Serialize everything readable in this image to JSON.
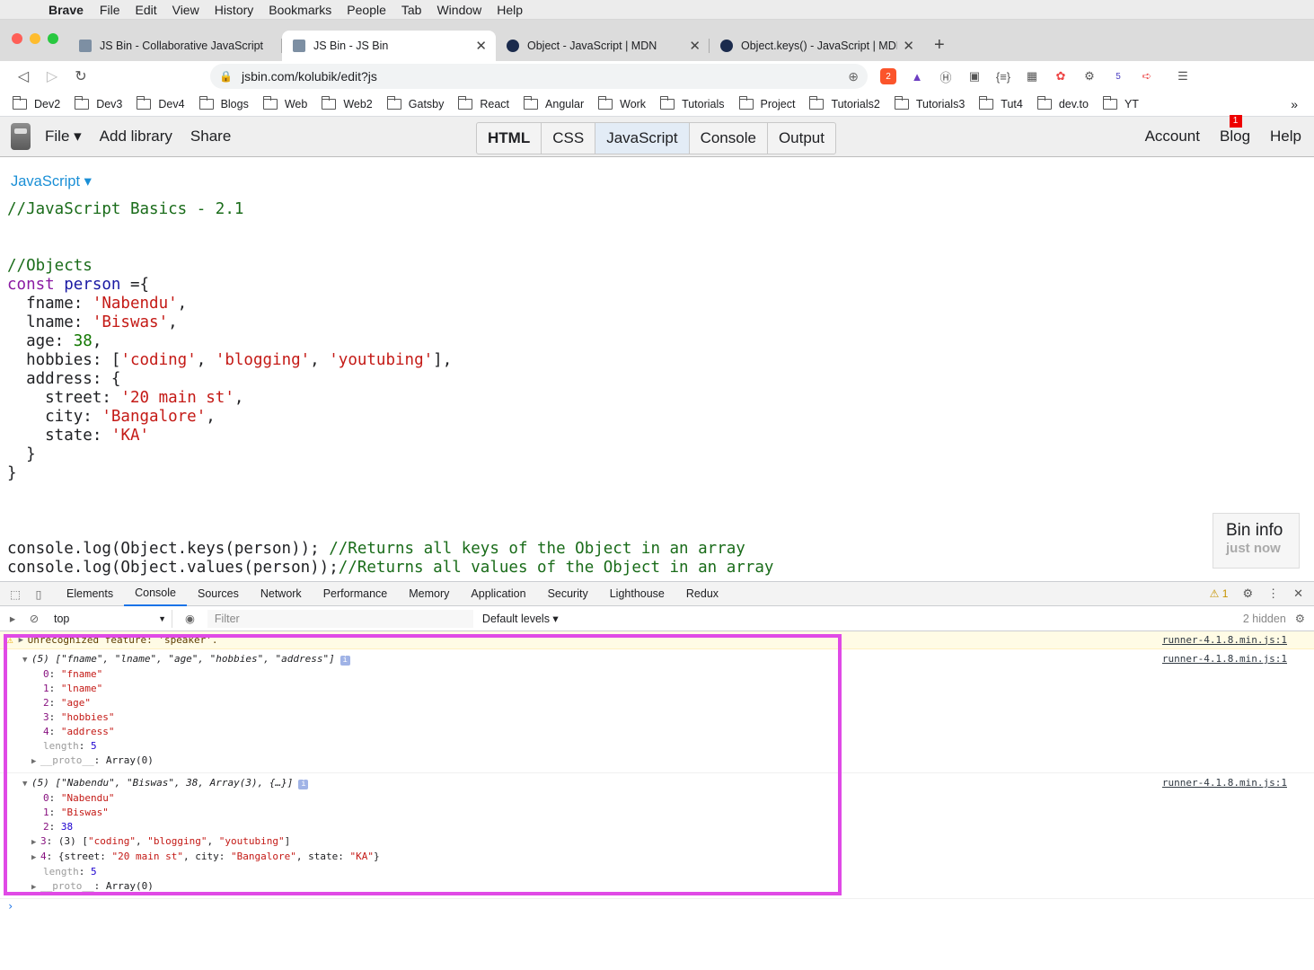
{
  "macmenu": {
    "app": "Brave",
    "items": [
      "File",
      "Edit",
      "View",
      "History",
      "Bookmarks",
      "People",
      "Tab",
      "Window",
      "Help"
    ]
  },
  "tabs": [
    {
      "title": "JS Bin - Collaborative JavaScript",
      "active": false
    },
    {
      "title": "JS Bin - JS Bin",
      "active": true
    },
    {
      "title": "Object - JavaScript | MDN",
      "active": false
    },
    {
      "title": "Object.keys() - JavaScript | MDN",
      "active": false
    }
  ],
  "url": "jsbin.com/kolubik/edit?js",
  "shield_count": "2",
  "ext_badge": "5",
  "bookmarks": [
    "Dev2",
    "Dev3",
    "Dev4",
    "Blogs",
    "Web",
    "Web2",
    "Gatsby",
    "React",
    "Angular",
    "Work",
    "Tutorials",
    "Project",
    "Tutorials2",
    "Tutorials3",
    "Tut4",
    "dev.to",
    "YT"
  ],
  "jsbin": {
    "menu": {
      "file": "File ▾",
      "add_library": "Add library",
      "share": "Share"
    },
    "panels": [
      "HTML",
      "CSS",
      "JavaScript",
      "Console",
      "Output"
    ],
    "right": {
      "account": "Account",
      "blog": "Blog",
      "blog_badge": "1",
      "help": "Help"
    },
    "editor_lang": "JavaScript ▾",
    "bininfo": {
      "title": "Bin info",
      "time": "just now"
    }
  },
  "code": {
    "l1": "//JavaScript Basics - 2.1",
    "l2": "//Objects",
    "kw_const": "const",
    "var_person": "person",
    "l3_rest": " ={",
    "fname_k": "  fname: ",
    "fname_v": "'Nabendu'",
    "lname_k": "  lname: ",
    "lname_v": "'Biswas'",
    "age_k": "  age: ",
    "age_v": "38",
    "hob_k": "  hobbies: [",
    "hob_1": "'coding'",
    "hob_2": "'blogging'",
    "hob_3": "'youtubing'",
    "hob_end": "],",
    "addr": "  address: {",
    "street_k": "    street: ",
    "street_v": "'20 main st'",
    "city_k": "    city: ",
    "city_v": "'Bangalore'",
    "state_k": "    state: ",
    "state_v": "'KA'",
    "close1": "  }",
    "close2": "}",
    "log1_code": "console.log(Object.keys(person)); ",
    "log1_cm": "//Returns all keys of the Object in an array",
    "log2_code": "console.log(Object.values(person));",
    "log2_cm": "//Returns all values of the Object in an array"
  },
  "devtools": {
    "tabs": [
      "Elements",
      "Console",
      "Sources",
      "Network",
      "Performance",
      "Memory",
      "Application",
      "Security",
      "Lighthouse",
      "Redux"
    ],
    "active_tab": "Console",
    "warn_count": "1",
    "context": "top",
    "filter_placeholder": "Filter",
    "levels": "Default levels ▾",
    "hidden": "2 hidden"
  },
  "console": {
    "warning": "Unrecognized feature: 'speaker'.",
    "source": "runner-4.1.8.min.js:1",
    "keys_header": "(5) [\"fname\", \"lname\", \"age\", \"hobbies\", \"address\"]",
    "keys": [
      {
        "i": "0",
        "v": "\"fname\""
      },
      {
        "i": "1",
        "v": "\"lname\""
      },
      {
        "i": "2",
        "v": "\"age\""
      },
      {
        "i": "3",
        "v": "\"hobbies\""
      },
      {
        "i": "4",
        "v": "\"address\""
      }
    ],
    "length_label": "length",
    "length_val": "5",
    "proto_label": "__proto__",
    "proto_val": "Array(0)",
    "values_header": "(5) [\"Nabendu\", \"Biswas\", 38, Array(3), {…}]",
    "values": {
      "v0": "\"Nabendu\"",
      "v1": "\"Biswas\"",
      "v2": "38",
      "v3_pre": "(3) [",
      "v3_a": "\"coding\"",
      "v3_b": "\"blogging\"",
      "v3_c": "\"youtubing\"",
      "v3_post": "]",
      "v4_pre": "{",
      "v4_sk": "street",
      "v4_sv": "\"20 main st\"",
      "v4_ck": "city",
      "v4_cv": "\"Bangalore\"",
      "v4_tk": "state",
      "v4_tv": "\"KA\"",
      "v4_post": "}"
    },
    "prompt": "›"
  }
}
